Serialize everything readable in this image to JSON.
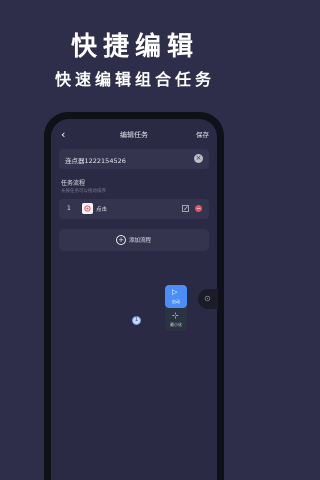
{
  "promo": {
    "title": "快捷编辑",
    "subtitle": "快速编辑组合任务"
  },
  "appbar": {
    "back_icon": "chevron-left-icon",
    "title": "编辑任务",
    "save_label": "保存"
  },
  "task_name": {
    "value": "连点器1222154526",
    "clear_icon": "clear-circle-icon"
  },
  "flow": {
    "section_title": "任务流程",
    "hint": "长按任务可以拖动排序",
    "steps": [
      {
        "index": "1",
        "icon": "tap-icon",
        "label": "点击"
      }
    ],
    "add_label": "添加流程",
    "add_icon": "plus-circle-icon"
  },
  "floating_panel": {
    "run_label": "启动",
    "run_icon": "play-icon",
    "minimize_label": "最小化",
    "minimize_icon": "collapse-icon"
  },
  "click_target": {
    "label": "1"
  },
  "colors": {
    "background": "#2f2e4a",
    "card": "#35344f",
    "accent": "#4c8ef7",
    "danger": "#e0566a"
  }
}
